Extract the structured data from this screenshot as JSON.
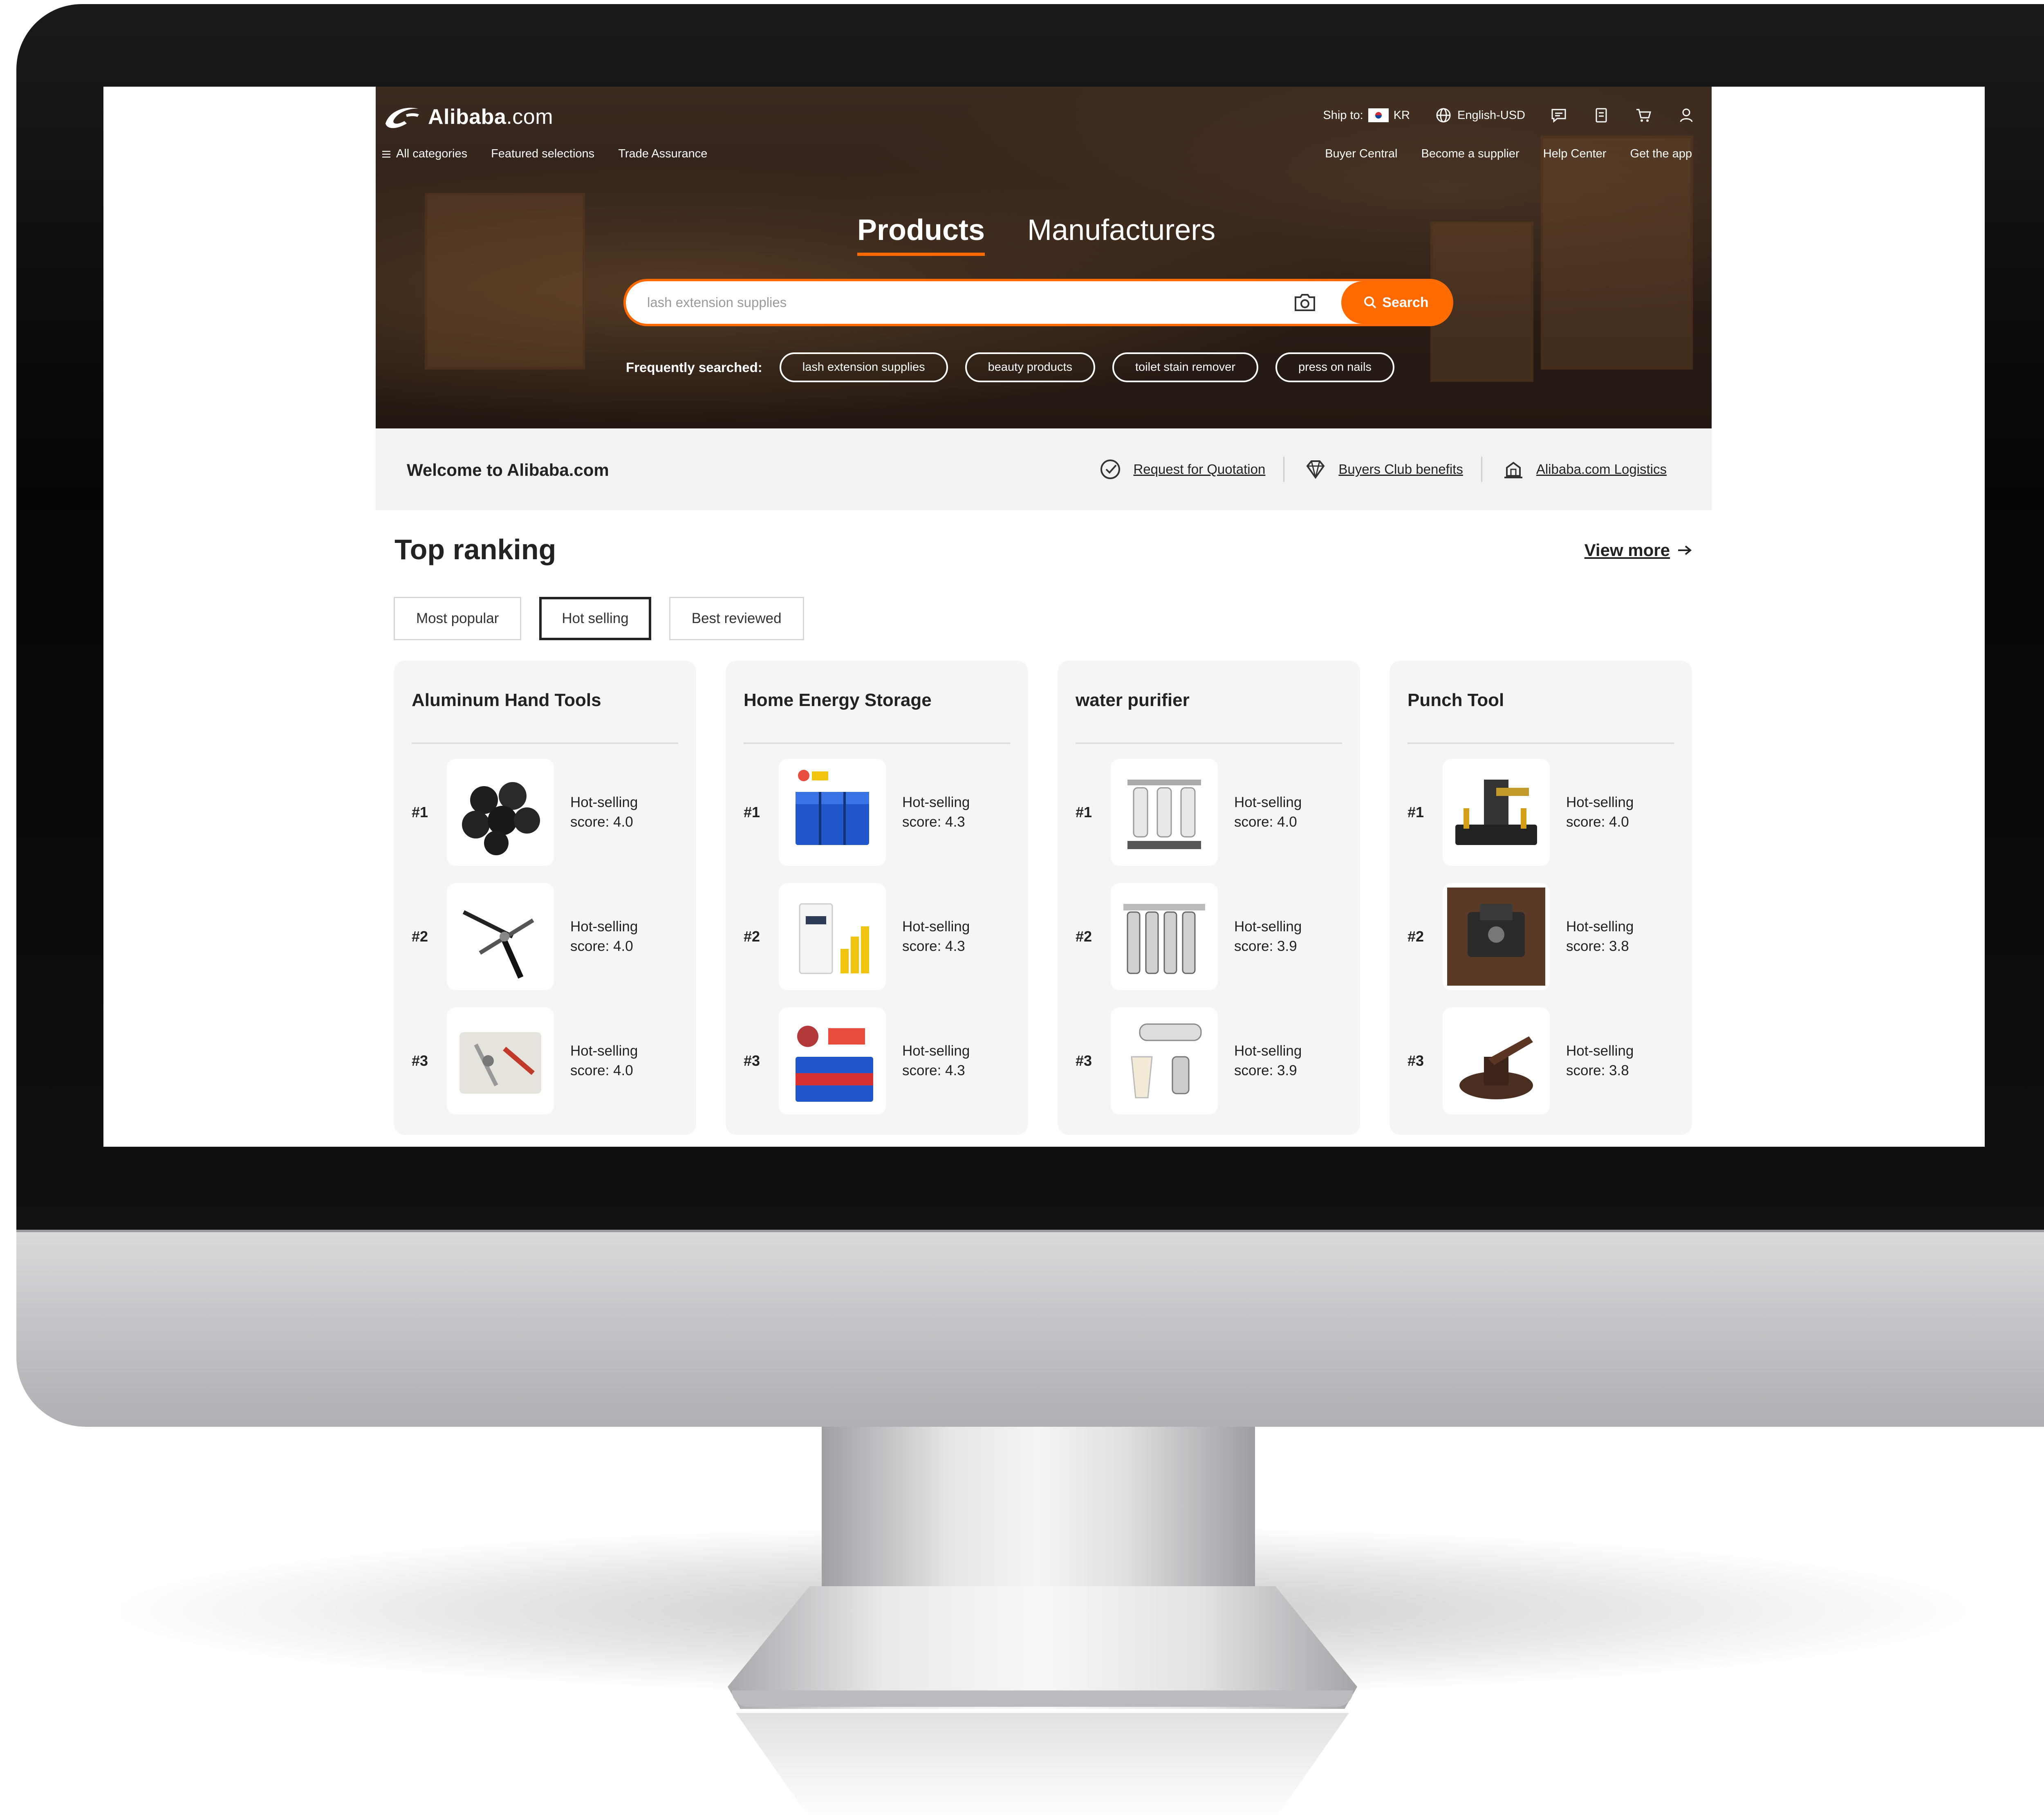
{
  "header": {
    "logo_text": "Alibaba",
    "logo_suffix": ".com",
    "nav": {
      "all_categories": "All categories",
      "featured": "Featured selections",
      "trade_assurance": "Trade Assurance"
    },
    "ship_to_label": "Ship to:",
    "ship_to_country": "KR",
    "language": "English-USD",
    "right_nav": [
      "Buyer Central",
      "Become a supplier",
      "Help Center",
      "Get the app"
    ]
  },
  "tabs": [
    {
      "label": "Products",
      "active": true
    },
    {
      "label": "Manufacturers",
      "active": false
    }
  ],
  "search": {
    "placeholder": "lash extension supplies",
    "button_label": "Search"
  },
  "frequently_searched": {
    "label": "Frequently searched:",
    "chips": [
      "lash extension supplies",
      "beauty products",
      "toilet stain remover",
      "press on nails"
    ]
  },
  "welcome": {
    "title": "Welcome to Alibaba.com",
    "links": [
      "Request for Quotation",
      "Buyers Club benefits",
      "Alibaba.com Logistics"
    ]
  },
  "ranking": {
    "title": "Top ranking",
    "view_more": "View more",
    "filters": [
      {
        "label": "Most popular",
        "selected": false
      },
      {
        "label": "Hot selling",
        "selected": true
      },
      {
        "label": "Best reviewed",
        "selected": false
      }
    ],
    "categories": [
      {
        "title": "Aluminum Hand Tools",
        "items": [
          {
            "rank": "#1",
            "score_label": "Hot-selling",
            "score": "score: 4.0"
          },
          {
            "rank": "#2",
            "score_label": "Hot-selling",
            "score": "score: 4.0"
          },
          {
            "rank": "#3",
            "score_label": "Hot-selling",
            "score": "score: 4.0"
          }
        ]
      },
      {
        "title": "Home Energy Storage",
        "items": [
          {
            "rank": "#1",
            "score_label": "Hot-selling",
            "score": "score: 4.3"
          },
          {
            "rank": "#2",
            "score_label": "Hot-selling",
            "score": "score: 4.3"
          },
          {
            "rank": "#3",
            "score_label": "Hot-selling",
            "score": "score: 4.3"
          }
        ]
      },
      {
        "title": "water purifier",
        "items": [
          {
            "rank": "#1",
            "score_label": "Hot-selling",
            "score": "score: 4.0"
          },
          {
            "rank": "#2",
            "score_label": "Hot-selling",
            "score": "score: 3.9"
          },
          {
            "rank": "#3",
            "score_label": "Hot-selling",
            "score": "score: 3.9"
          }
        ]
      },
      {
        "title": "Punch Tool",
        "items": [
          {
            "rank": "#1",
            "score_label": "Hot-selling",
            "score": "score: 4.0"
          },
          {
            "rank": "#2",
            "score_label": "Hot-selling",
            "score": "score: 3.8"
          },
          {
            "rank": "#3",
            "score_label": "Hot-selling",
            "score": "score: 3.8"
          }
        ]
      }
    ]
  },
  "icons": [
    "alibaba-logo-icon",
    "menu-icon",
    "flag-kr-icon",
    "globe-icon",
    "message-icon",
    "orders-icon",
    "cart-icon",
    "user-icon",
    "camera-icon",
    "search-icon",
    "rfq-icon",
    "diamond-icon",
    "logistics-icon",
    "arrow-right-icon"
  ],
  "colors": {
    "accent": "#ff6a00",
    "text": "#222222",
    "card_bg": "#f5f5f5"
  }
}
